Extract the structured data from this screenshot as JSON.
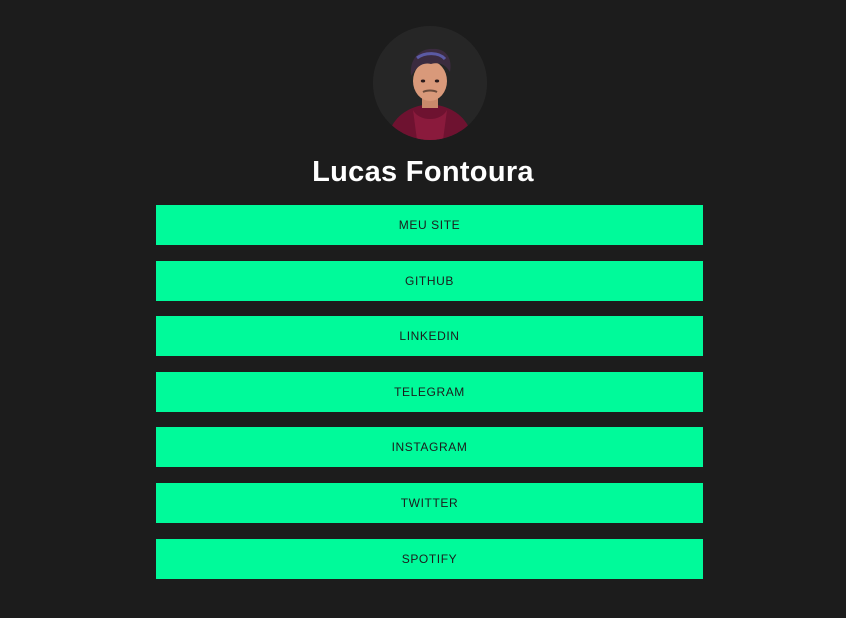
{
  "profile": {
    "name": "Lucas Fontoura"
  },
  "links": [
    {
      "label": "MEU SITE"
    },
    {
      "label": "GITHUB"
    },
    {
      "label": "LINKEDIN"
    },
    {
      "label": "TELEGRAM"
    },
    {
      "label": "INSTAGRAM"
    },
    {
      "label": "TWITTER"
    },
    {
      "label": "SPOTIFY"
    }
  ],
  "colors": {
    "background": "#1c1c1c",
    "button": "#00fa9a",
    "button_text": "#1c1c1c",
    "name_text": "#ffffff"
  }
}
